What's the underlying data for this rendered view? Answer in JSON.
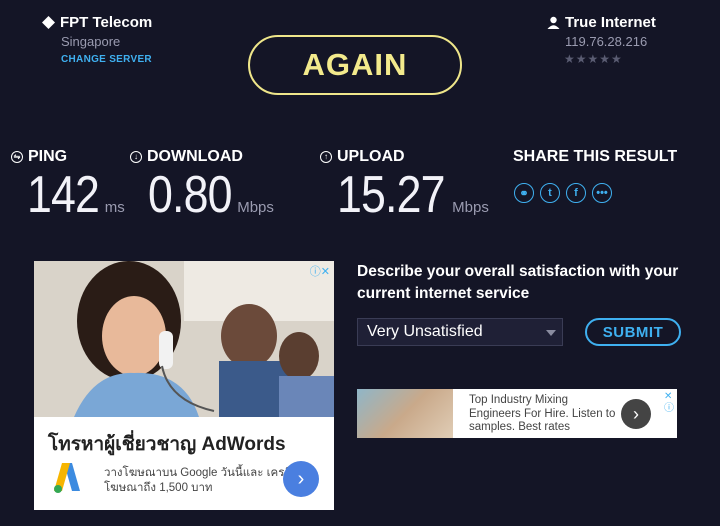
{
  "server": {
    "name": "FPT Telecom",
    "location": "Singapore",
    "change_label": "CHANGE SERVER"
  },
  "isp": {
    "name": "True Internet",
    "ip": "119.76.28.216",
    "stars": "★★★★★"
  },
  "again_label": "AGAIN",
  "metrics": {
    "ping": {
      "label": "PING",
      "value": "142",
      "unit": "ms"
    },
    "download": {
      "label": "DOWNLOAD",
      "value": "0.80",
      "unit": "Mbps"
    },
    "upload": {
      "label": "UPLOAD",
      "value": "15.27",
      "unit": "Mbps"
    }
  },
  "share": {
    "label": "SHARE THIS RESULT",
    "icons": [
      "link-icon",
      "twitter-icon",
      "facebook-icon",
      "more-icon"
    ]
  },
  "ad_left": {
    "title": "โทรหาผู้เชี่ยวชาญ AdWords",
    "text": "วางโฆษณาบน Google วันนี้และ เครดิตโฆษณาถึง 1,500 บาท",
    "arrow": "›",
    "info": "ⓘ✕"
  },
  "survey": {
    "question": "Describe your overall satisfaction with your current internet service",
    "selected": "Very Unsatisfied",
    "submit_label": "SUBMIT"
  },
  "ad_right": {
    "text": "Top Industry Mixing Engineers For Hire. Listen to samples. Best rates",
    "arrow": "›",
    "info": "✕ⓘ"
  },
  "colors": {
    "background": "#141526",
    "accent_yellow": "#f3ea8c",
    "accent_blue": "#3fb0f0"
  }
}
